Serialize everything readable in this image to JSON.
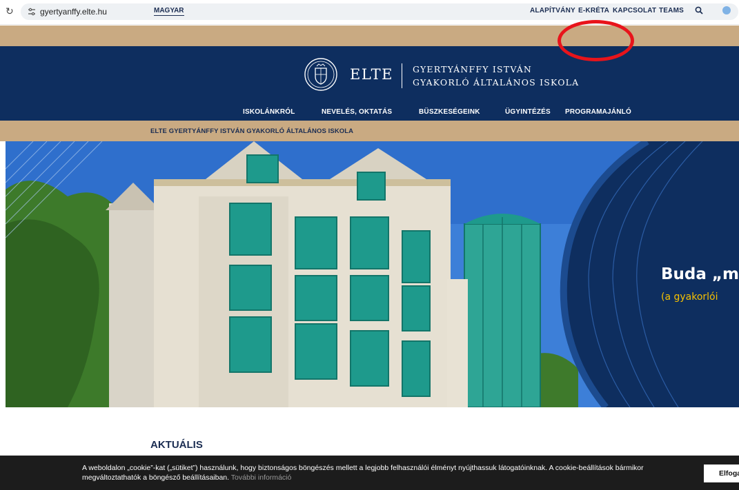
{
  "browser": {
    "url": "gyertyanffy.elte.hu"
  },
  "utility_bar": {
    "language": "MAGYAR",
    "links": [
      "ALAPÍTVÁNY",
      "E-KRÉTA",
      "KAPCSOLAT",
      "TEAMS"
    ]
  },
  "header": {
    "logo_text": "ELTE",
    "school_line1": "GYERTYÁNFFY ISTVÁN",
    "school_line2": "GYAKORLÓ ÁLTALÁNOS ISKOLA"
  },
  "nav": {
    "items": [
      "ISKOLÁNKRÓL",
      "NEVELÉS, OKTATÁS",
      "BÜSZKESÉGEINK",
      "ÜGYINTÉZÉS",
      "PROGRAMAJÁNLÓ"
    ]
  },
  "breadcrumb": {
    "text": "ELTE GYERTYÁNFFY ISTVÁN GYAKORLÓ ÁLTALÁNOS ISKOLA"
  },
  "hero": {
    "heading": "Buda „m",
    "subheading": "(a gyakorlói"
  },
  "news": {
    "title": "AKTUÁLIS"
  },
  "cookie": {
    "text": "A weboldalon „cookie”-kat („sütiket”) használunk, hogy biztonságos böngészés mellett a legjobb felhasználói élményt nyújthassuk látogatóinknak. A cookie-beállítások bármikor megváltoztathatók a böngésző beállításaiban.",
    "more_link": "További információ",
    "accept_label": "Elfoga"
  },
  "colors": {
    "navy": "#0e2e5f",
    "tan": "#c9aa82",
    "teal": "#1e9a8c",
    "annotation": "#e8141b"
  },
  "icons": [
    "reload-icon",
    "site-info-icon",
    "search-icon",
    "globe-icon",
    "elte-seal-icon"
  ]
}
